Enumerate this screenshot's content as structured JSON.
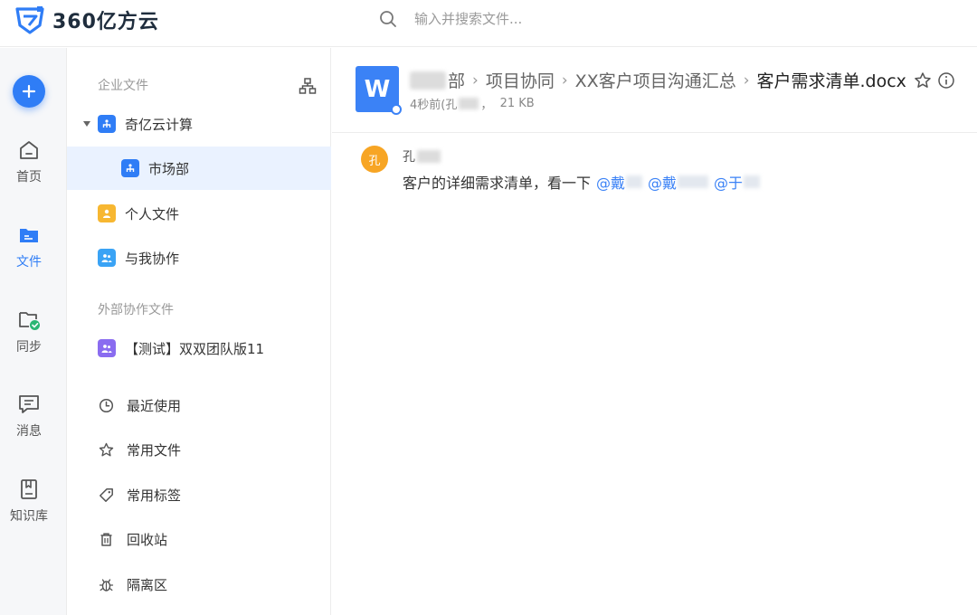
{
  "header": {
    "app_name": "360亿方云",
    "search_placeholder": "输入并搜索文件...",
    "brand_color": "#2f7df6"
  },
  "rail": {
    "items": [
      {
        "label": "首页",
        "icon": "home-icon"
      },
      {
        "label": "文件",
        "icon": "folder-icon",
        "active": true
      },
      {
        "label": "同步",
        "icon": "sync-folder-icon"
      },
      {
        "label": "消息",
        "icon": "message-icon"
      },
      {
        "label": "知识库",
        "icon": "knowledge-base-icon"
      }
    ]
  },
  "tree": {
    "enterprise_title": "企业文件",
    "external_title": "外部协作文件",
    "items": [
      {
        "label": "奇亿云计算",
        "icon": "org-badge-icon",
        "expanded": true
      },
      {
        "label": "市场部",
        "icon": "org-badge-icon",
        "selected": true
      },
      {
        "label": "个人文件",
        "icon": "person-badge-icon"
      },
      {
        "label": "与我协作",
        "icon": "collab-badge-icon"
      },
      {
        "label": "【测试】双双团队版11",
        "icon": "team-badge-icon"
      }
    ],
    "nav": [
      {
        "label": "最近使用",
        "icon": "clock-icon"
      },
      {
        "label": "常用文件",
        "icon": "star-icon"
      },
      {
        "label": "常用标签",
        "icon": "tag-icon"
      },
      {
        "label": "回收站",
        "icon": "trash-icon"
      },
      {
        "label": "隔离区",
        "icon": "bug-icon"
      }
    ]
  },
  "file": {
    "breadcrumb": [
      "部",
      "项目协同",
      "XX客户项目沟通汇总"
    ],
    "name": "客户需求清单.docx",
    "modified": "4秒前(孔",
    "size": "21 KB",
    "icon_letter": "W"
  },
  "comment": {
    "avatar_text": "孔",
    "author": "孔",
    "text": "客户的详细需求清单，看一下",
    "mentions": [
      "@戴",
      "@戴",
      "@于"
    ]
  }
}
